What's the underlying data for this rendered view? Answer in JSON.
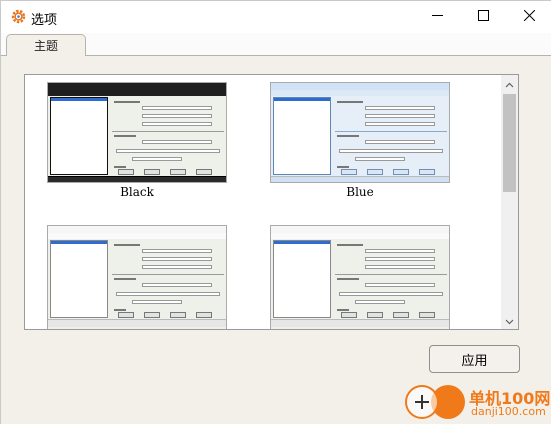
{
  "window": {
    "title": "选项",
    "icon": "gear-icon",
    "controls": [
      "minimize-icon",
      "maximize-icon",
      "close-icon"
    ]
  },
  "tabs": [
    {
      "label": "主题",
      "selected": true
    }
  ],
  "themes": [
    {
      "label": "Black"
    },
    {
      "label": "Blue"
    },
    {
      "label": ""
    },
    {
      "label": ""
    }
  ],
  "actions": {
    "apply_label": "应用"
  },
  "watermark": {
    "text": "单机100网",
    "url": "danji100.com"
  },
  "colors": {
    "accent": "#f07a1a",
    "selection": "#2f6ccf",
    "panel": "#f3f0ea"
  }
}
